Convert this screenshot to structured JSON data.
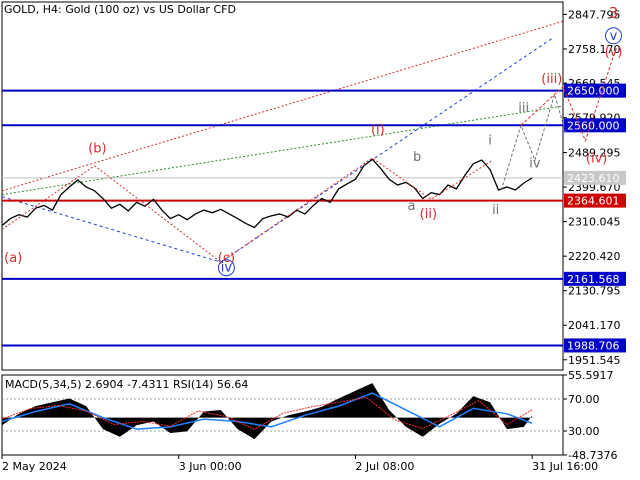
{
  "header": {
    "title": "GOLD, H4:  Gold (100 oz) vs US Dollar CFD"
  },
  "indicator": {
    "label": "MACD(5,34,5) 2.6904 -7.4311 RSI(14) 56.64"
  },
  "colors": {
    "price_line": "#000000",
    "level_blue": "#0000c8",
    "level_red": "#cc0000",
    "wave_red": "#d62d2d",
    "wave_blue": "#1f3fd1",
    "wave_gray": "#707070",
    "trend_green": "#2e8b2e",
    "macd_fill": "#000000",
    "signal_line": "#1e7fff",
    "rsi_line": "#ff2a2a"
  },
  "chart_data": [
    {
      "type": "line",
      "symbol": "GOLD",
      "timeframe": "H4",
      "y_ticks": [
        "2847.795",
        "2758.170",
        "2669.545",
        "2579.920",
        "2489.295",
        "2399.670",
        "2310.045",
        "2220.420",
        "2130.795",
        "2041.170",
        "1951.545"
      ],
      "x_ticks": [
        "2 May 2024",
        "3 Jun 00:00",
        "2 Jul 08:00",
        "31 Jul 16:00"
      ],
      "ylim": [
        1925,
        2880
      ],
      "current_price_label": "2423.610",
      "levels": [
        {
          "label": "2650.000",
          "value": 2650.0,
          "color": "blue"
        },
        {
          "label": "2560.000",
          "value": 2560.0,
          "color": "blue"
        },
        {
          "label": "2364.601",
          "value": 2364.601,
          "color": "red"
        },
        {
          "label": "2161.568",
          "value": 2161.568,
          "color": "blue"
        },
        {
          "label": "1988.706",
          "value": 1988.706,
          "color": "blue"
        }
      ],
      "price_series": [
        {
          "t": 0,
          "v": 2300
        },
        {
          "t": 3,
          "v": 2318
        },
        {
          "t": 6,
          "v": 2328
        },
        {
          "t": 9,
          "v": 2322
        },
        {
          "t": 12,
          "v": 2345
        },
        {
          "t": 15,
          "v": 2352
        },
        {
          "t": 18,
          "v": 2340
        },
        {
          "t": 21,
          "v": 2380
        },
        {
          "t": 24,
          "v": 2400
        },
        {
          "t": 27,
          "v": 2418
        },
        {
          "t": 30,
          "v": 2400
        },
        {
          "t": 33,
          "v": 2390
        },
        {
          "t": 36,
          "v": 2370
        },
        {
          "t": 39,
          "v": 2345
        },
        {
          "t": 42,
          "v": 2355
        },
        {
          "t": 45,
          "v": 2338
        },
        {
          "t": 48,
          "v": 2360
        },
        {
          "t": 51,
          "v": 2350
        },
        {
          "t": 54,
          "v": 2368
        },
        {
          "t": 57,
          "v": 2340
        },
        {
          "t": 60,
          "v": 2318
        },
        {
          "t": 63,
          "v": 2328
        },
        {
          "t": 66,
          "v": 2315
        },
        {
          "t": 69,
          "v": 2330
        },
        {
          "t": 72,
          "v": 2340
        },
        {
          "t": 75,
          "v": 2333
        },
        {
          "t": 78,
          "v": 2342
        },
        {
          "t": 81,
          "v": 2330
        },
        {
          "t": 84,
          "v": 2318
        },
        {
          "t": 87,
          "v": 2305
        },
        {
          "t": 90,
          "v": 2295
        },
        {
          "t": 93,
          "v": 2318
        },
        {
          "t": 96,
          "v": 2325
        },
        {
          "t": 99,
          "v": 2330
        },
        {
          "t": 102,
          "v": 2322
        },
        {
          "t": 105,
          "v": 2340
        },
        {
          "t": 108,
          "v": 2330
        },
        {
          "t": 111,
          "v": 2352
        },
        {
          "t": 114,
          "v": 2370
        },
        {
          "t": 117,
          "v": 2360
        },
        {
          "t": 120,
          "v": 2395
        },
        {
          "t": 123,
          "v": 2408
        },
        {
          "t": 126,
          "v": 2420
        },
        {
          "t": 129,
          "v": 2455
        },
        {
          "t": 132,
          "v": 2472
        },
        {
          "t": 135,
          "v": 2448
        },
        {
          "t": 138,
          "v": 2420
        },
        {
          "t": 141,
          "v": 2405
        },
        {
          "t": 144,
          "v": 2412
        },
        {
          "t": 147,
          "v": 2398
        },
        {
          "t": 150,
          "v": 2370
        },
        {
          "t": 153,
          "v": 2385
        },
        {
          "t": 156,
          "v": 2380
        },
        {
          "t": 159,
          "v": 2405
        },
        {
          "t": 162,
          "v": 2395
        },
        {
          "t": 165,
          "v": 2430
        },
        {
          "t": 168,
          "v": 2460
        },
        {
          "t": 171,
          "v": 2470
        },
        {
          "t": 174,
          "v": 2445
        },
        {
          "t": 177,
          "v": 2392
        },
        {
          "t": 180,
          "v": 2400
        },
        {
          "t": 183,
          "v": 2392
        },
        {
          "t": 186,
          "v": 2410
        },
        {
          "t": 189,
          "v": 2423.61
        }
      ],
      "wave_labels": [
        {
          "text": "(a)",
          "color": "red"
        },
        {
          "text": "(b)",
          "color": "red"
        },
        {
          "text": "(c)",
          "color": "red"
        },
        {
          "text": "iv",
          "color": "blue",
          "circled": true
        },
        {
          "text": "(i)",
          "color": "red"
        },
        {
          "text": "a",
          "color": "gray"
        },
        {
          "text": "b",
          "color": "gray"
        },
        {
          "text": "(ii)",
          "color": "red"
        },
        {
          "text": "i",
          "color": "gray"
        },
        {
          "text": "ii",
          "color": "gray"
        },
        {
          "text": "iii",
          "color": "gray"
        },
        {
          "text": "iv",
          "color": "gray"
        },
        {
          "text": "(iii)",
          "color": "red"
        },
        {
          "text": "(iv)",
          "color": "red"
        },
        {
          "text": "(v)",
          "color": "red"
        },
        {
          "text": "v",
          "color": "blue",
          "circled": true
        },
        {
          "text": "3",
          "color": "red"
        }
      ]
    },
    {
      "type": "area",
      "indicators": [
        "MACD(5,34,5)",
        "RSI(14)"
      ],
      "macd_main": 2.6904,
      "macd_signal": -7.4311,
      "rsi": 56.64,
      "y_ticks": [
        "55.5917",
        "70.00",
        "30.00",
        "-48.7376"
      ],
      "macd_series": [
        {
          "t": 0,
          "v": -10
        },
        {
          "t": 6,
          "v": 5
        },
        {
          "t": 12,
          "v": 15
        },
        {
          "t": 18,
          "v": 20
        },
        {
          "t": 24,
          "v": 25
        },
        {
          "t": 30,
          "v": 15
        },
        {
          "t": 36,
          "v": -15
        },
        {
          "t": 42,
          "v": -25
        },
        {
          "t": 48,
          "v": -10
        },
        {
          "t": 54,
          "v": -5
        },
        {
          "t": 60,
          "v": -20
        },
        {
          "t": 66,
          "v": -18
        },
        {
          "t": 72,
          "v": 8
        },
        {
          "t": 78,
          "v": 10
        },
        {
          "t": 84,
          "v": -15
        },
        {
          "t": 90,
          "v": -28
        },
        {
          "t": 96,
          "v": -5
        },
        {
          "t": 102,
          "v": 3
        },
        {
          "t": 108,
          "v": 8
        },
        {
          "t": 114,
          "v": 14
        },
        {
          "t": 120,
          "v": 25
        },
        {
          "t": 126,
          "v": 35
        },
        {
          "t": 132,
          "v": 45
        },
        {
          "t": 138,
          "v": 10
        },
        {
          "t": 144,
          "v": -12
        },
        {
          "t": 150,
          "v": -25
        },
        {
          "t": 156,
          "v": -8
        },
        {
          "t": 162,
          "v": 5
        },
        {
          "t": 168,
          "v": 28
        },
        {
          "t": 174,
          "v": 20
        },
        {
          "t": 180,
          "v": -15
        },
        {
          "t": 186,
          "v": -12
        },
        {
          "t": 189,
          "v": 2.69
        }
      ],
      "signal_series": [
        {
          "t": 0,
          "v": -5
        },
        {
          "t": 12,
          "v": 8
        },
        {
          "t": 24,
          "v": 18
        },
        {
          "t": 36,
          "v": 0
        },
        {
          "t": 48,
          "v": -15
        },
        {
          "t": 60,
          "v": -12
        },
        {
          "t": 72,
          "v": -2
        },
        {
          "t": 84,
          "v": -5
        },
        {
          "t": 96,
          "v": -12
        },
        {
          "t": 108,
          "v": 3
        },
        {
          "t": 120,
          "v": 15
        },
        {
          "t": 132,
          "v": 32
        },
        {
          "t": 144,
          "v": 10
        },
        {
          "t": 156,
          "v": -12
        },
        {
          "t": 168,
          "v": 12
        },
        {
          "t": 180,
          "v": 5
        },
        {
          "t": 189,
          "v": -7.43
        }
      ],
      "rsi_series": [
        {
          "t": 0,
          "v": 45
        },
        {
          "t": 10,
          "v": 58
        },
        {
          "t": 20,
          "v": 62
        },
        {
          "t": 30,
          "v": 55
        },
        {
          "t": 40,
          "v": 38
        },
        {
          "t": 50,
          "v": 42
        },
        {
          "t": 60,
          "v": 36
        },
        {
          "t": 70,
          "v": 55
        },
        {
          "t": 80,
          "v": 48
        },
        {
          "t": 90,
          "v": 32
        },
        {
          "t": 100,
          "v": 52
        },
        {
          "t": 110,
          "v": 60
        },
        {
          "t": 120,
          "v": 66
        },
        {
          "t": 130,
          "v": 72
        },
        {
          "t": 140,
          "v": 44
        },
        {
          "t": 150,
          "v": 33
        },
        {
          "t": 160,
          "v": 50
        },
        {
          "t": 170,
          "v": 68
        },
        {
          "t": 180,
          "v": 38
        },
        {
          "t": 189,
          "v": 56.64
        }
      ]
    }
  ]
}
